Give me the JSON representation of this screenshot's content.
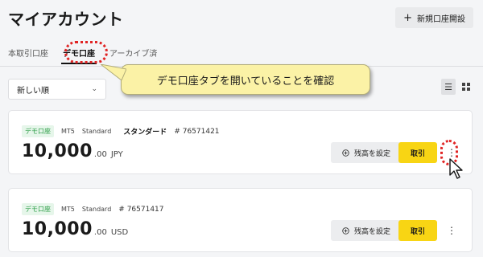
{
  "page": {
    "title": "マイアカウント",
    "new_account_label": "新規口座開設"
  },
  "tabs": [
    {
      "label": "本取引口座"
    },
    {
      "label": "デモ口座"
    },
    {
      "label": "アーカイブ済"
    }
  ],
  "active_tab": "デモ口座",
  "sort": {
    "selected": "新しい順"
  },
  "callout": {
    "text": "デモ口座タブを開いていることを確認"
  },
  "accounts": [
    {
      "badge": "デモ口座",
      "platform": "MT5",
      "type": "Standard",
      "name": "スタンダード",
      "number": "# 76571421",
      "amount": "10,000",
      "decimals": ".00",
      "currency": "JPY",
      "set_balance_label": "残高を設定",
      "trade_label": "取引"
    },
    {
      "badge": "デモ口座",
      "platform": "MT5",
      "type": "Standard",
      "name": "",
      "number": "# 76571417",
      "amount": "10,000",
      "decimals": ".00",
      "currency": "USD",
      "set_balance_label": "残高を設定",
      "trade_label": "取引"
    }
  ],
  "colors": {
    "accent_yellow": "#f8d514",
    "demo_badge_green": "#2e9e48",
    "annotation_red": "#e02424",
    "callout_bg": "#fbf2a6"
  },
  "icons": [
    "plus-icon",
    "chevron-down-icon",
    "list-view-icon",
    "grid-view-icon",
    "plus-circle-icon",
    "more-vertical-icon",
    "mouse-cursor-icon"
  ]
}
